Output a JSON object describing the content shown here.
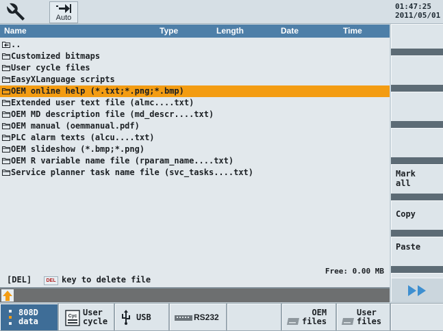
{
  "header": {
    "tool_icon": "wrench-icon",
    "mode_icon": "arrow-right-to-bar-icon",
    "mode_label": "Auto",
    "clock_time": "01:47:25",
    "clock_date": "2011/05/01"
  },
  "columns": {
    "name": "Name",
    "type": "Type",
    "length": "Length",
    "date": "Date",
    "time": "Time"
  },
  "files": [
    {
      "name": "..",
      "icon": "parent-dir-icon",
      "selected": false
    },
    {
      "name": "Customized bitmaps",
      "icon": "folder-icon",
      "selected": false
    },
    {
      "name": "User cycle files",
      "icon": "folder-icon",
      "selected": false
    },
    {
      "name": "EasyXLanguage scripts",
      "icon": "folder-icon",
      "selected": false
    },
    {
      "name": "OEM online help (*.txt;*.png;*.bmp)",
      "icon": "folder-icon",
      "selected": true
    },
    {
      "name": "Extended user text file (almc....txt)",
      "icon": "folder-icon",
      "selected": false
    },
    {
      "name": "OEM MD description file (md_descr....txt)",
      "icon": "folder-icon",
      "selected": false
    },
    {
      "name": "OEM manual (oemmanual.pdf)",
      "icon": "folder-icon",
      "selected": false
    },
    {
      "name": "PLC alarm texts (alcu....txt)",
      "icon": "folder-icon",
      "selected": false
    },
    {
      "name": "OEM slideshow (*.bmp;*.png)",
      "icon": "folder-icon",
      "selected": false
    },
    {
      "name": "OEM R variable name file (rparam_name....txt)",
      "icon": "folder-icon",
      "selected": false
    },
    {
      "name": "Service planner task name file (svc_tasks....txt)",
      "icon": "folder-icon",
      "selected": false
    }
  ],
  "free_space": "Free: 0.00 MB",
  "hint": {
    "prefix": "[DEL]",
    "key_icon_text": "DEL",
    "text": "key to delete file"
  },
  "vertical_softkeys": [
    {
      "label": ""
    },
    {
      "label": ""
    },
    {
      "label": ""
    },
    {
      "label": ""
    },
    {
      "label": "Mark\nall"
    },
    {
      "label": "Copy"
    },
    {
      "label": "Paste"
    },
    {
      "label": ""
    }
  ],
  "next_icon": "double-chevron-right-icon",
  "horizontal_softkeys": [
    {
      "label": "808D\ndata",
      "active": true
    },
    {
      "label": "User\ncycle"
    },
    {
      "label": "USB"
    },
    {
      "label": "RS232"
    },
    {
      "label": ""
    },
    {
      "label": "OEM\nfiles"
    },
    {
      "label": "User\nfiles"
    },
    {
      "label": ""
    }
  ],
  "colors": {
    "header_bar": "#4e7fa8",
    "selection": "#f39c12",
    "softkey": "#dde5ea",
    "active_softkey": "#3e6d97"
  }
}
